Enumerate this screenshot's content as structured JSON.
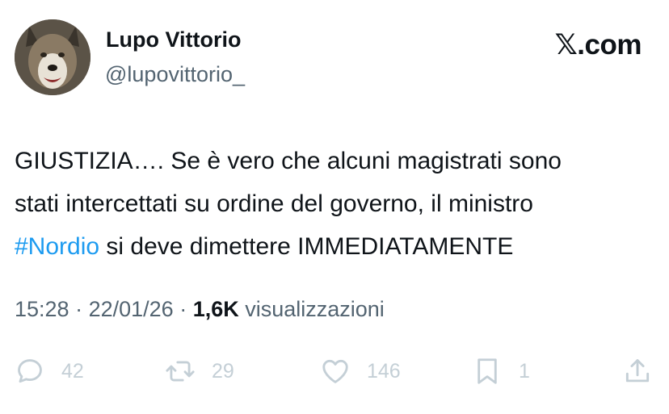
{
  "author": {
    "display_name": "Lupo Vittorio",
    "handle": "@lupovittorio_",
    "avatar_icon": "wolf-avatar"
  },
  "brand": {
    "label": "𝕏.com"
  },
  "tweet": {
    "line1": "GIUSTIZIA…. Se è vero che alcuni magistrati sono",
    "line2": "stati intercettati su ordine del governo, il ministro",
    "hashtag": "#Nordio",
    "line3_rest": " si deve dimettere IMMEDIATAMENTE"
  },
  "meta": {
    "time": "15:28",
    "sep1": " · ",
    "date": "22/01/26",
    "sep2": " · ",
    "views_count": "1,6K",
    "views_label": " visualizzazioni"
  },
  "actions": {
    "replies": "42",
    "reposts": "29",
    "likes": "146",
    "bookmarks": "1",
    "icon_color": "#c4cfd6"
  }
}
